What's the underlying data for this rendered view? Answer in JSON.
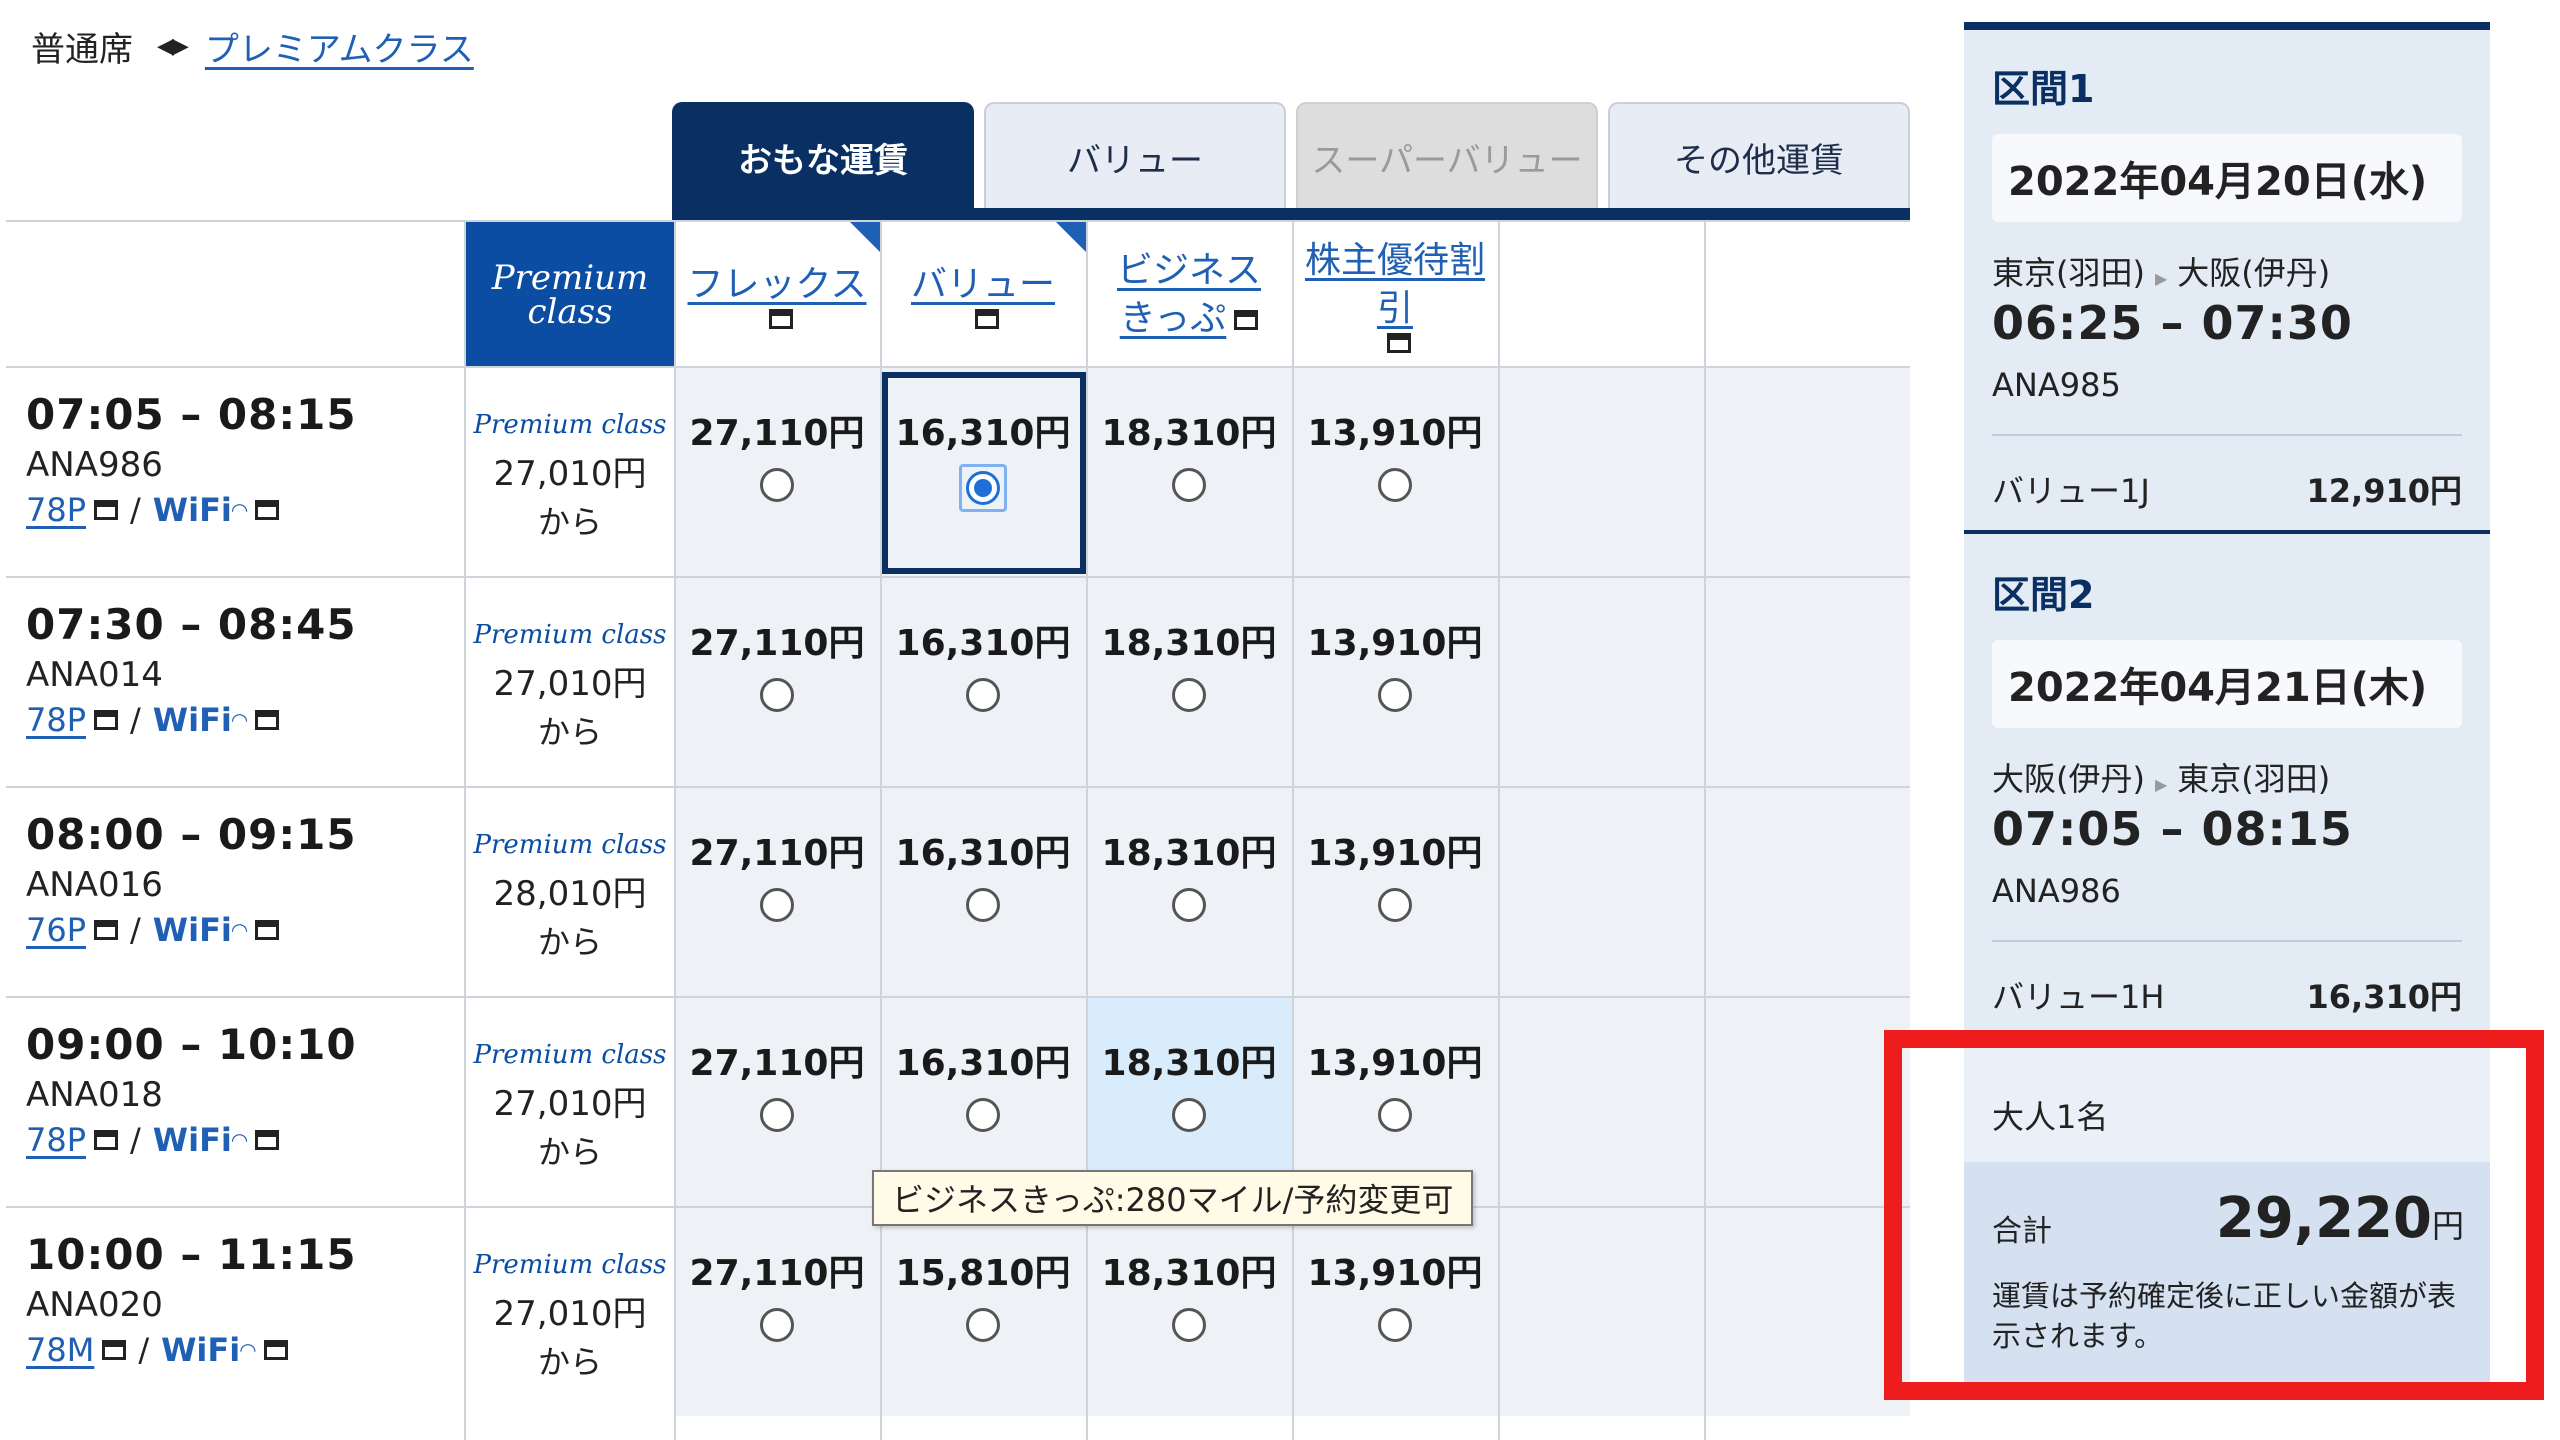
{
  "seat_switch": {
    "current": "普通席",
    "link": "プレミアムクラス"
  },
  "tabs": [
    "おもな運賃",
    "バリュー",
    "スーパーバリュー",
    "その他運賃"
  ],
  "columns": {
    "premium": [
      "Premium",
      "class"
    ],
    "fares": [
      {
        "l1": "フレックス",
        "l2": "",
        "corner": true
      },
      {
        "l1": "バリュー",
        "l2": "",
        "corner": true
      },
      {
        "l1": "ビジネス",
        "l2": "きっぷ",
        "corner": false
      },
      {
        "l1": "株主優待割引",
        "l2": "",
        "corner": false
      }
    ]
  },
  "premium_logo": "Premium class",
  "premium_from": "から",
  "wifi_label": "WiFi",
  "slash": "/",
  "flights": [
    {
      "time": "07:05 – 08:15",
      "fno": "ANA986",
      "seat": "78P",
      "premium": "27,010円",
      "fares": [
        "27,110円",
        "16,310円",
        "18,310円",
        "13,910円"
      ]
    },
    {
      "time": "07:30 – 08:45",
      "fno": "ANA014",
      "seat": "78P",
      "premium": "27,010円",
      "fares": [
        "27,110円",
        "16,310円",
        "18,310円",
        "13,910円"
      ]
    },
    {
      "time": "08:00 – 09:15",
      "fno": "ANA016",
      "seat": "76P",
      "premium": "28,010円",
      "fares": [
        "27,110円",
        "16,310円",
        "18,310円",
        "13,910円"
      ]
    },
    {
      "time": "09:00 – 10:10",
      "fno": "ANA018",
      "seat": "78P",
      "premium": "27,010円",
      "fares": [
        "27,110円",
        "16,310円",
        "18,310円",
        "13,910円"
      ]
    },
    {
      "time": "10:00 – 11:15",
      "fno": "ANA020",
      "seat": "78M",
      "premium": "27,010円",
      "fares": [
        "27,110円",
        "15,810円",
        "18,310円",
        "13,910円"
      ]
    }
  ],
  "selected": {
    "row": 0,
    "col": 1
  },
  "tooltip": "ビジネスきっぷ:280マイル/予約変更可",
  "summary": {
    "segments": [
      {
        "title": "区間1",
        "date": "2022年04月20日(水)",
        "from": "東京(羽田)",
        "to": "大阪(伊丹)",
        "time": "06:25 – 07:30",
        "fno": "ANA985",
        "fare_name": "バリュー1J",
        "fare_amt": "12,910円"
      },
      {
        "title": "区間2",
        "date": "2022年04月21日(木)",
        "from": "大阪(伊丹)",
        "to": "東京(羽田)",
        "time": "07:05 – 08:15",
        "fno": "ANA986",
        "fare_name": "バリュー1H",
        "fare_amt": "16,310円"
      }
    ],
    "passengers": "大人1名",
    "total_label": "合計",
    "total_amount": "29,220",
    "yen": "円",
    "note": "運賃は予約確定後に正しい金額が表示されます。"
  },
  "colors": {
    "navy": "#0a2f63",
    "link": "#1f5fb4",
    "highlight": "#ee1c1c",
    "radio": "#1f6fd8"
  }
}
